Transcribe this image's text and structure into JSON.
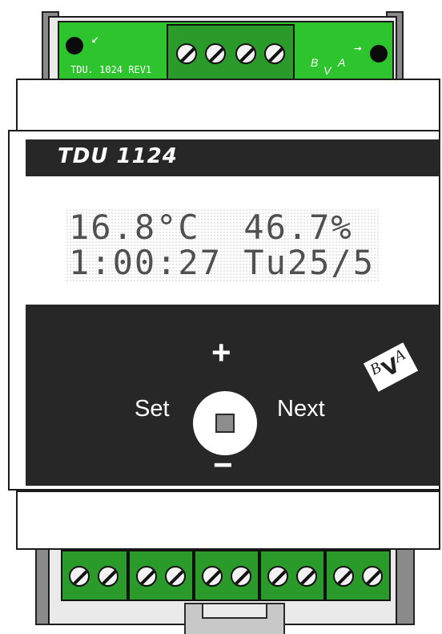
{
  "device": {
    "model": "TDU 1124",
    "board_revision": "TDU. 1024 REV1"
  },
  "display": {
    "line1": "16.8°C  46.7%",
    "line2": "1:00:27 Tu25/5"
  },
  "controls": {
    "up_symbol": "+",
    "down_symbol": "−",
    "left_label": "Set",
    "right_label": "Next"
  },
  "logo": {
    "letter_left": "B",
    "letter_mid": "V",
    "letter_right": "A"
  },
  "pcb_markings": {
    "arrow_left": "↙",
    "arrow_right": "→"
  },
  "colors": {
    "pcb_green": "#2ec42e",
    "terminal_green": "#2a9a2a",
    "panel_dark": "#272727",
    "lcd_text": "#505050"
  }
}
